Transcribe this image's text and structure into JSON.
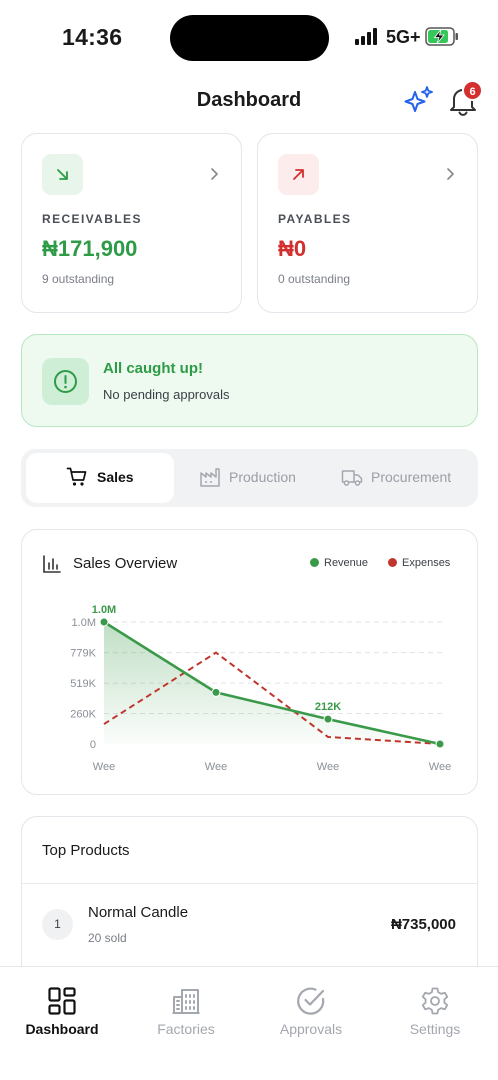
{
  "status_bar": {
    "time": "14:36",
    "network": "5G+"
  },
  "header": {
    "title": "Dashboard",
    "notification_count": "6"
  },
  "summary": {
    "receivables": {
      "label": "RECEIVABLES",
      "amount": "₦171,900",
      "sub": "9 outstanding"
    },
    "payables": {
      "label": "PAYABLES",
      "amount": "₦0",
      "sub": "0 outstanding"
    }
  },
  "alert": {
    "title": "All caught up!",
    "subtitle": "No pending approvals"
  },
  "tabs": [
    {
      "label": "Sales",
      "icon": "cart-icon",
      "active": true
    },
    {
      "label": "Production",
      "icon": "factory-icon",
      "active": false
    },
    {
      "label": "Procurement",
      "icon": "truck-icon",
      "active": false
    }
  ],
  "sales_overview": {
    "title": "Sales Overview"
  },
  "chart_data": {
    "type": "line",
    "title": "Sales Overview",
    "categories": [
      "Wee",
      "Wee",
      "Wee",
      "Wee"
    ],
    "ylim": [
      0,
      1040000
    ],
    "y_ticks": [
      "0",
      "260K",
      "519K",
      "779K",
      "1.0M"
    ],
    "y_tick_values": [
      0,
      260000,
      519000,
      779000,
      1040000
    ],
    "grid": true,
    "legend_position": "top-right",
    "series": [
      {
        "name": "Revenue",
        "values": [
          1040000,
          440000,
          212000,
          0
        ],
        "color": "#3b9a4a",
        "style": "solid",
        "area": true
      },
      {
        "name": "Expenses",
        "values": [
          170000,
          779000,
          60000,
          0
        ],
        "color": "#c0362c",
        "style": "dashed"
      }
    ],
    "annotations": [
      {
        "series": "Revenue",
        "index": 0,
        "text": "1.0M"
      },
      {
        "series": "Revenue",
        "index": 2,
        "text": "212K"
      }
    ]
  },
  "top_products": {
    "title": "Top Products",
    "items": [
      {
        "rank": "1",
        "name": "Normal Candle",
        "sold": "20 sold",
        "amount": "₦735,000"
      }
    ]
  },
  "bottom_nav": [
    {
      "label": "Dashboard",
      "icon": "grid-icon",
      "active": true
    },
    {
      "label": "Factories",
      "icon": "building-icon",
      "active": false
    },
    {
      "label": "Approvals",
      "icon": "check-circle-icon",
      "active": false
    },
    {
      "label": "Settings",
      "icon": "gear-icon",
      "active": false
    }
  ],
  "colors": {
    "green": "#2e9b46",
    "red": "#d32f2f",
    "revenue": "#3b9a4a",
    "expenses": "#c0362c"
  }
}
